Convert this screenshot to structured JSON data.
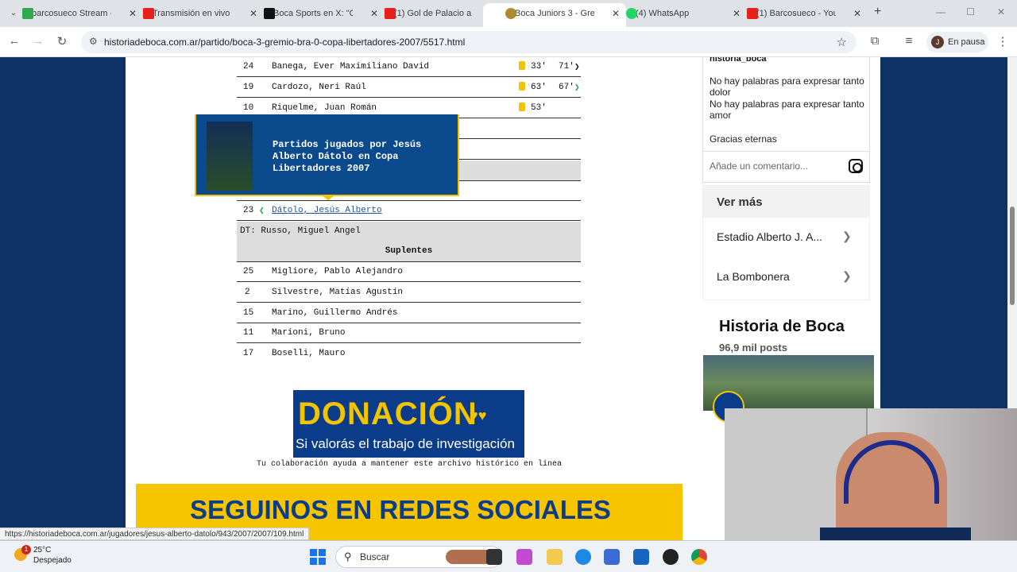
{
  "browser": {
    "tabs": [
      {
        "title": "barcosueco Stream -",
        "active": false,
        "color": "#2fa84f"
      },
      {
        "title": "Transmisión en vivo",
        "active": false,
        "color": "#e62117"
      },
      {
        "title": "Boca Sports en X: \"O",
        "active": false,
        "color": "#111111"
      },
      {
        "title": "(1) Gol de Palacio a C",
        "active": false,
        "color": "#e62117"
      },
      {
        "title": "Boca Juniors 3 - Grer",
        "active": true,
        "color": "#b08a2e"
      },
      {
        "title": "(4) WhatsApp",
        "active": false,
        "color": "#25d366"
      },
      {
        "title": "(1) Barcosueco - You",
        "active": false,
        "color": "#e62117"
      }
    ],
    "url": "historiadeboca.com.ar/partido/boca-3-gremio-bra-0-copa-libertadores-2007/5517.html",
    "profile_initial": "J",
    "profile_status": "En pausa"
  },
  "lineup": {
    "starters": [
      {
        "number": "24",
        "name": "Banega, Ever Maximiliano David",
        "card": "33'",
        "sub": "71'",
        "sub_arrow": "❯"
      },
      {
        "number": "19",
        "name": "Cardozo, Neri Raúl",
        "card": "63'",
        "sub": "67'",
        "sub_arrow": "❯"
      },
      {
        "number": "10",
        "name": "Riquelme, Juan Román",
        "card": "53'",
        "sub": "",
        "sub_arrow": ""
      }
    ],
    "sub_in": {
      "number": "23",
      "arrow": "❮",
      "name": "Dátolo, Jesús Alberto"
    },
    "coach": "DT: Russo, Miguel Angel",
    "subs_header": "Suplentes",
    "substitutes": [
      {
        "number": "25",
        "name": "Migliore, Pablo Alejandro"
      },
      {
        "number": "2",
        "name": "Silvestre, Matías Agustín"
      },
      {
        "number": "15",
        "name": "Marino, Guillermo Andrés"
      },
      {
        "number": "11",
        "name": "Marioni, Bruno"
      },
      {
        "number": "17",
        "name": "Boselli, Mauro"
      }
    ]
  },
  "tooltip": {
    "text": "Partidos jugados por Jesús Alberto Dátolo en Copa Libertadores 2007"
  },
  "donation": {
    "title": "DONACIÓN",
    "subtitle": "Si valorás el trabajo de investigación",
    "caption": "Tu colaboración ayuda a mantener este archivo histórico en línea"
  },
  "social_banner": "SEGUINOS EN REDES SOCIALES",
  "instagram": {
    "username": "historia_boca",
    "lines": [
      "No hay palabras para expresar tanto dolor",
      "No hay palabras para expresar tanto amor",
      "Gracias eternas"
    ],
    "comment_placeholder": "Añade un comentario..."
  },
  "ver_mas": {
    "title": "Ver más",
    "items": [
      "Estadio Alberto J. A...",
      "La Bombonera"
    ]
  },
  "page_card": {
    "name": "Historia de Boca",
    "posts": "96,9 mil posts"
  },
  "status_url": "https://historiadeboca.com.ar/jugadores/jesus-alberto-datolo/943/2007/2007/109.html",
  "taskbar": {
    "temp": "25°C",
    "weather": "Despejado",
    "notif": "1",
    "search": "Buscar"
  }
}
